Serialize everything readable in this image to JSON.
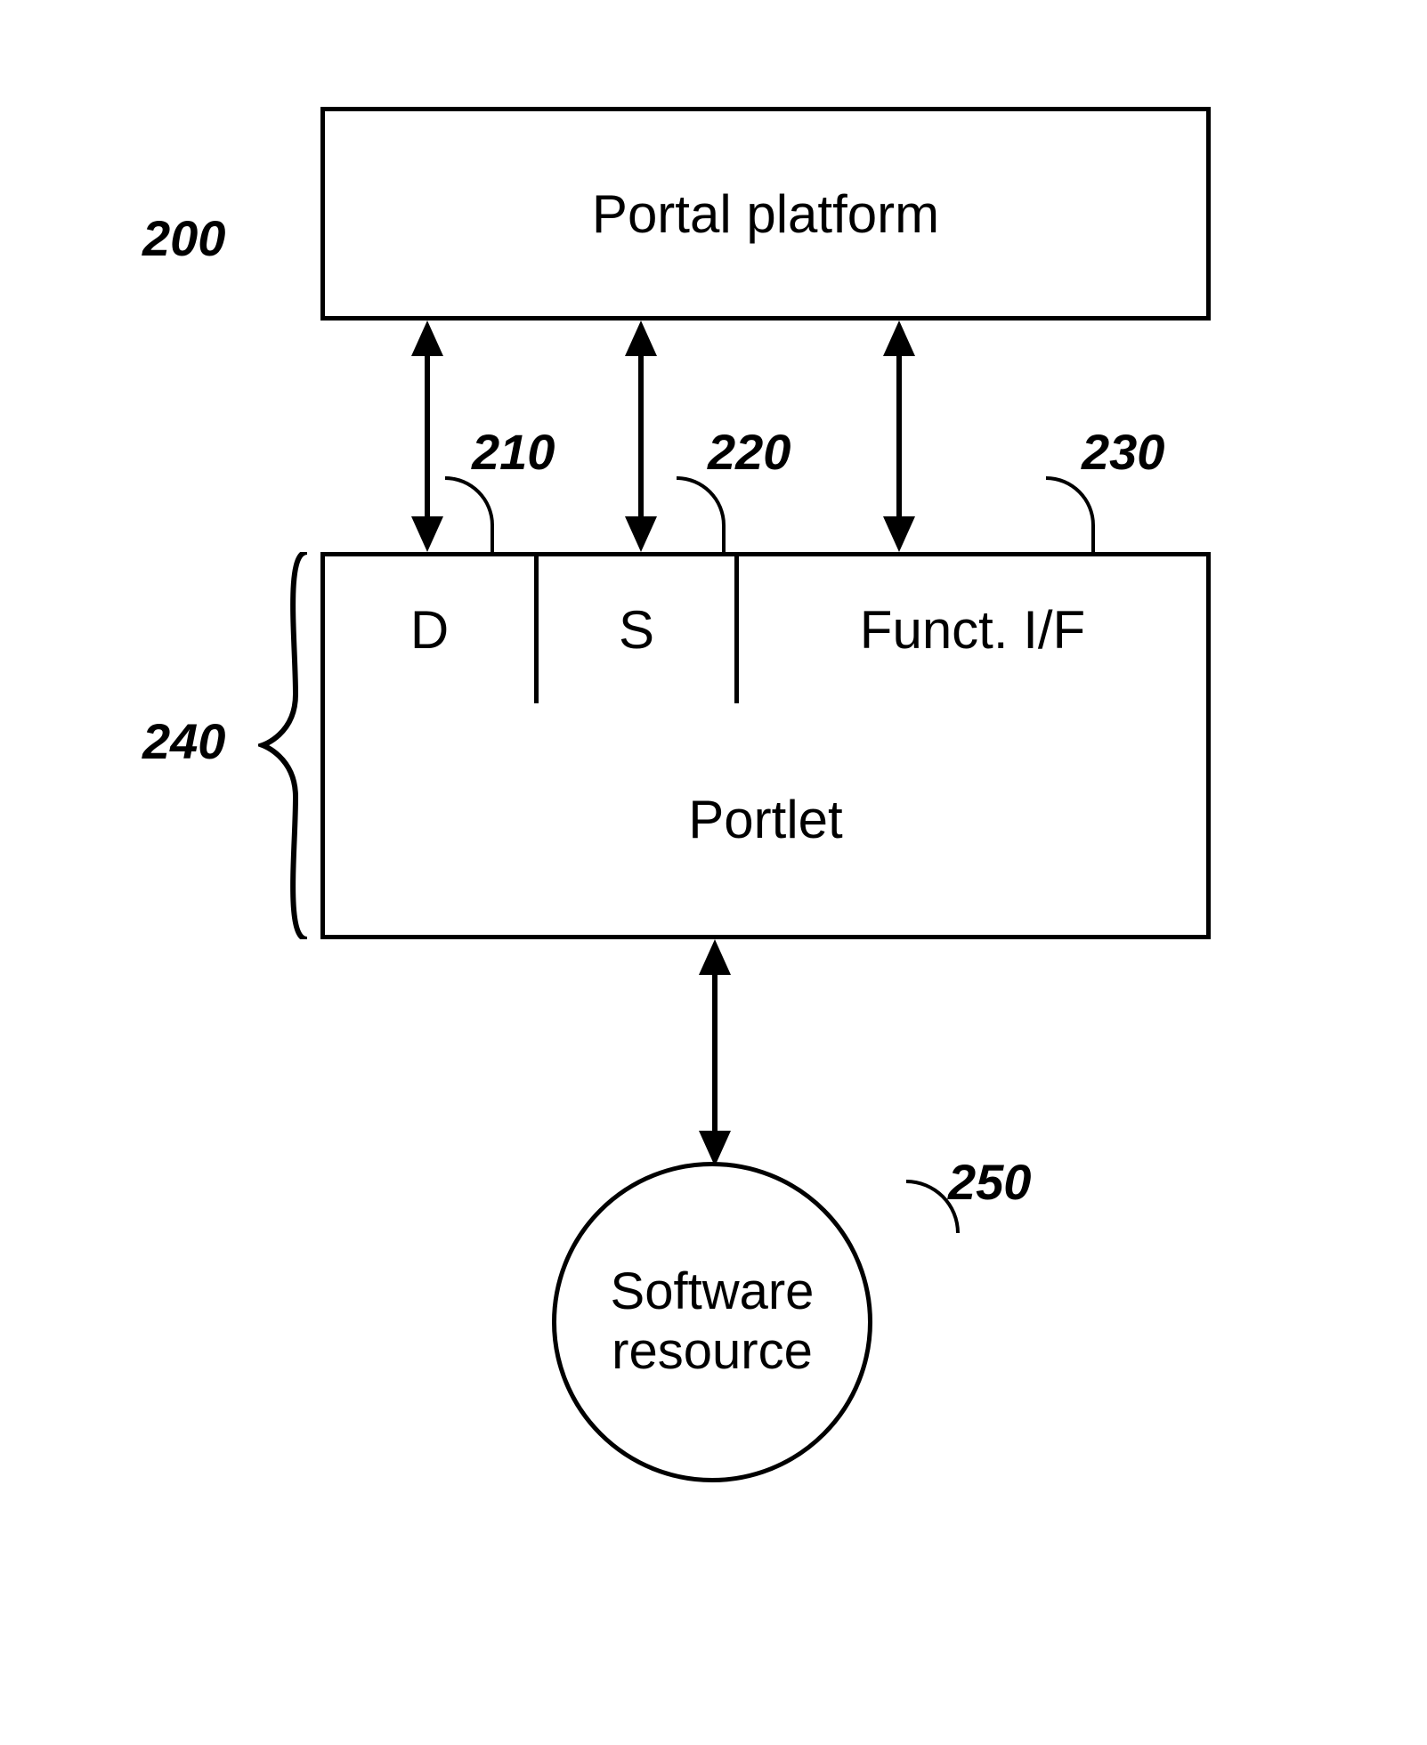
{
  "labels": {
    "portal": "Portal platform",
    "d": "D",
    "s": "S",
    "funct": "Funct. I/F",
    "portlet": "Portlet",
    "software": "Software resource"
  },
  "refs": {
    "r200": "200",
    "r210": "210",
    "r220": "220",
    "r230": "230",
    "r240": "240",
    "r250": "250"
  }
}
